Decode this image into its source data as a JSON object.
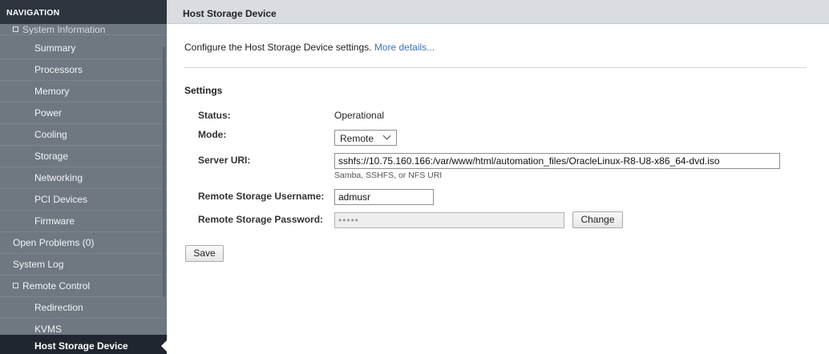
{
  "nav": {
    "header": "NAVIGATION",
    "cut_item": "System Information",
    "items": [
      {
        "label": "Summary"
      },
      {
        "label": "Processors"
      },
      {
        "label": "Memory"
      },
      {
        "label": "Power"
      },
      {
        "label": "Cooling"
      },
      {
        "label": "Storage"
      },
      {
        "label": "Networking"
      },
      {
        "label": "PCI Devices"
      },
      {
        "label": "Firmware"
      },
      {
        "label": "Open Problems (0)"
      },
      {
        "label": "System Log"
      },
      {
        "label": "Remote Control"
      },
      {
        "label": "Redirection"
      },
      {
        "label": "KVMS"
      },
      {
        "label": "Host Storage Device"
      }
    ]
  },
  "page": {
    "title": "Host Storage Device",
    "intro_text": "Configure the Host Storage Device settings.",
    "more_link": "More details...",
    "section_title": "Settings"
  },
  "settings": {
    "status_label": "Status:",
    "status_value": "Operational",
    "mode_label": "Mode:",
    "mode_value": "Remote",
    "server_uri_label": "Server URI:",
    "server_uri_value": "sshfs://10.75.160.166:/var/www/html/automation_files/OracleLinux-R8-U8-x86_64-dvd.iso",
    "server_uri_hint": "Samba, SSHFS, or NFS URI",
    "username_label": "Remote Storage Username:",
    "username_value": "admusr",
    "password_label": "Remote Storage Password:",
    "password_value": "•••••",
    "change_button": "Change",
    "save_button": "Save"
  },
  "colors": {
    "sidebar_bg": "#6f7780",
    "sidebar_header_bg": "#2e353d",
    "active_item_bg": "#1f2630",
    "link": "#3b73b9",
    "page_header_bg": "#d9dde2"
  }
}
